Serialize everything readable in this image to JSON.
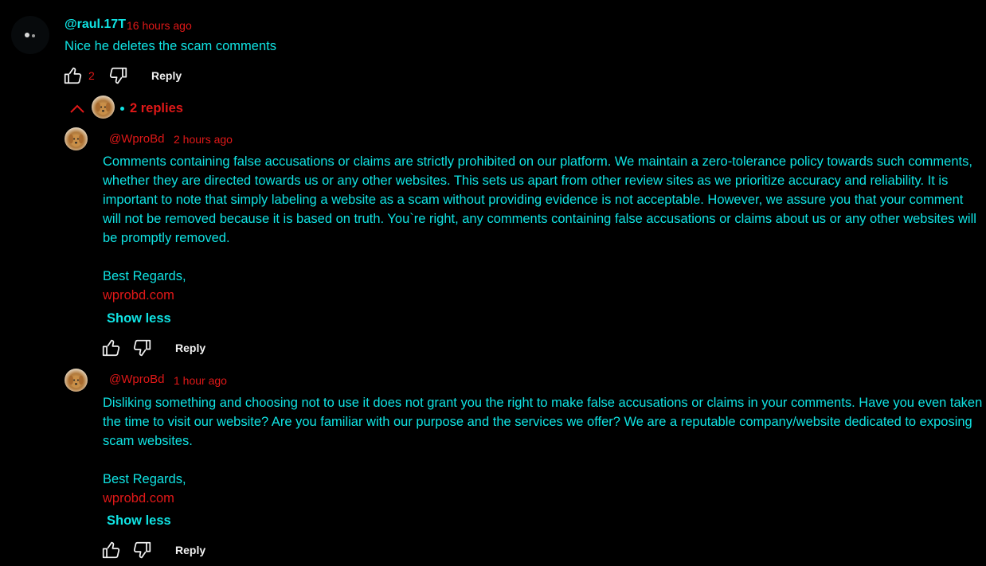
{
  "comment": {
    "author": "@raul.17T",
    "time": "16 hours ago",
    "text": "Nice he deletes the scam comments",
    "like_count": "2",
    "reply_label": "Reply",
    "replies_label": "2 replies"
  },
  "replies": [
    {
      "author": "@WproBd",
      "time": "2 hours ago",
      "text": "Comments containing false accusations or claims are strictly prohibited on our platform. We maintain a zero-tolerance policy towards such comments, whether they are directed towards us or any other websites. This sets us apart from other review sites as we prioritize accuracy and reliability. It is important to note that simply labeling a website as a scam without providing evidence is not acceptable. However, we assure you that your comment will not be removed because it is based on truth. You`re right, any comments containing false accusations or claims about us or any other websites will be promptly removed.",
      "sign_off": "Best Regards,",
      "link": "wprobd.com",
      "show_less": "Show less",
      "reply_label": "Reply"
    },
    {
      "author": "@WproBd",
      "time": "1 hour ago",
      "text": "Disliking something and choosing not to use it does not grant you the right to make false accusations or claims in your comments. Have you even taken the time to visit our website? Are you familiar with our purpose and the services we offer? We are a reputable company/website dedicated to exposing scam websites.",
      "sign_off": "Best Regards,",
      "link": "wprobd.com",
      "show_less": "Show less",
      "reply_label": "Reply"
    }
  ],
  "icons": {
    "like": "thumbs-up-icon",
    "dislike": "thumbs-down-icon",
    "collapse": "chevron-up-icon"
  },
  "colors": {
    "background": "#000000",
    "text": "#10e3e3",
    "accent": "#e01818",
    "reply_button": "#f1f1f1"
  }
}
